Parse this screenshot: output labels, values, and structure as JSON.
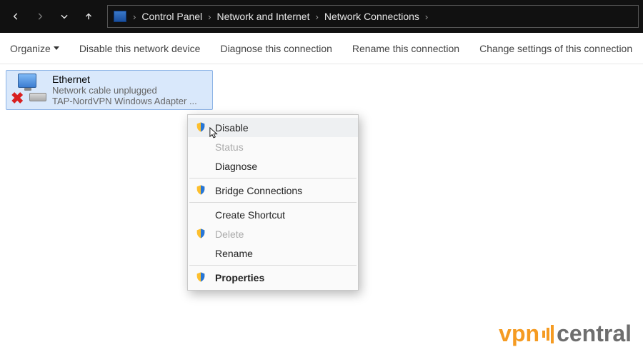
{
  "breadcrumb": {
    "items": [
      "Control Panel",
      "Network and Internet",
      "Network Connections"
    ]
  },
  "toolbar": {
    "organize": "Organize",
    "disable_device": "Disable this network device",
    "diagnose": "Diagnose this connection",
    "rename": "Rename this connection",
    "change_settings": "Change settings of this connection"
  },
  "adapter": {
    "name": "Ethernet",
    "status": "Network cable unplugged",
    "device": "TAP-NordVPN Windows Adapter ..."
  },
  "context_menu": {
    "disable": "Disable",
    "status": "Status",
    "diagnose": "Diagnose",
    "bridge": "Bridge Connections",
    "create_shortcut": "Create Shortcut",
    "delete": "Delete",
    "rename": "Rename",
    "properties": "Properties"
  },
  "watermark": {
    "left": "vpn",
    "right": "central"
  }
}
